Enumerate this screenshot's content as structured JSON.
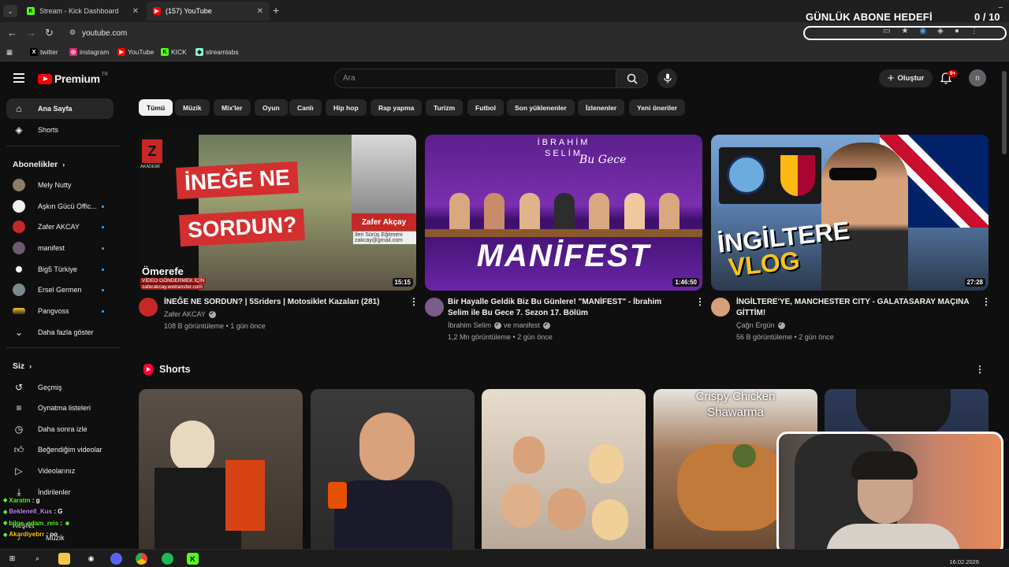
{
  "browser": {
    "tabs": [
      {
        "title": "Stream - Kick Dashboard",
        "active": false
      },
      {
        "title": "(157) YouTube",
        "active": true
      }
    ],
    "url": "youtube.com",
    "bookmarks": [
      "twitter",
      "instagram",
      "YouTube",
      "KICK",
      "streamlabs"
    ]
  },
  "overlay": {
    "goal_title": "GÜNLÜK ABONE HEDEFİ",
    "goal_count": "0 / 10",
    "goal_progress": 0
  },
  "header": {
    "brand": "Premium",
    "region": "TR",
    "search_placeholder": "Ara",
    "create_label": "Oluştur",
    "notification_badge": "9+",
    "avatar_letter": "n"
  },
  "sidebar": {
    "main": [
      {
        "label": "Ana Sayfa",
        "icon": "home-icon",
        "active": true
      },
      {
        "label": "Shorts",
        "icon": "shorts-icon",
        "active": false
      }
    ],
    "subscriptions_title": "Abonelikler",
    "subscriptions": [
      {
        "label": "Mely Nutty",
        "dot": false
      },
      {
        "label": "Aşkın Gücü Offic...",
        "dot": true
      },
      {
        "label": "Zafer AKCAY",
        "dot": true
      },
      {
        "label": "manifest",
        "dot": true
      },
      {
        "label": "Big5 Türkiye",
        "dot": true
      },
      {
        "label": "Ersel Germen",
        "dot": true
      },
      {
        "label": "Pangvoss",
        "dot": true
      }
    ],
    "show_more": "Daha fazla göster",
    "you_title": "Siz",
    "you_items": [
      {
        "label": "Geçmiş",
        "icon": "history-icon"
      },
      {
        "label": "Oynatma listeleri",
        "icon": "playlists-icon"
      },
      {
        "label": "Daha sonra izle",
        "icon": "watch-later-icon"
      },
      {
        "label": "Beğendiğim videolar",
        "icon": "like-icon"
      },
      {
        "label": "Videolarınız",
        "icon": "your-videos-icon"
      },
      {
        "label": "İndirilenler",
        "icon": "download-icon"
      }
    ],
    "explore_title": "Keşfet",
    "explore_items": [
      {
        "label": "Müzik"
      }
    ]
  },
  "chips": [
    "Tümü",
    "Müzik",
    "Mix'ler",
    "Oyun",
    "Canlı",
    "Hip hop",
    "Rap yapma",
    "Turizm",
    "Futbol",
    "Son yüklenenler",
    "İzlenenler",
    "Yeni öneriler"
  ],
  "videos": [
    {
      "title": "İNEĞE NE SORDUN? | 5Sriders | Motosiklet Kazaları (281)",
      "channel": "Zafer AKCAY",
      "verified": true,
      "meta": "108 B görüntüleme • 1 gün önce",
      "duration": "15:15",
      "thumb_text": [
        "İNEĞE NE",
        "SORDUN?"
      ],
      "thumb_small": [
        "AKADEMİ",
        "Ömerefe",
        "VİDEO GÖNDERMEK İÇİN",
        "zaferakcay.wetransfer.com",
        "Zafer Akçay",
        "İleri Sürüş Eğitmeni",
        "zakcay@gmail.com"
      ]
    },
    {
      "title": "Bir Hayalle Geldik Biz Bu Günlere! \"MANİFEST\" - İbrahim Selim ile Bu Gece 7. Sezon 17. Bölüm",
      "channel": "İbrahim Selim",
      "channel_extra": "ve manifest",
      "verified": true,
      "meta": "1,2 Mn görüntüleme • 2 gün önce",
      "duration": "1:46:50",
      "thumb_text": [
        "MANİFEST"
      ],
      "thumb_small": [
        "İBRAHİM",
        "SELİM",
        "Bu Gece"
      ]
    },
    {
      "title": "İNGİLTERE'YE, MANCHESTER CITY - GALATASARAY MAÇINA GİTTİM!",
      "channel": "Çağrı Ergün",
      "verified": true,
      "meta": "56 B görüntüleme • 2 gün önce",
      "duration": "27:28",
      "thumb_text": [
        "İNGİLTERE",
        "VLOG"
      ],
      "thumb_small": []
    }
  ],
  "shorts": {
    "title": "Shorts",
    "items": [
      {
        "overlay_text": ""
      },
      {
        "overlay_text": ""
      },
      {
        "overlay_text": ""
      },
      {
        "overlay_text": "Crispy Chicken Shawarma"
      },
      {
        "overlay_text": ""
      }
    ]
  },
  "chat": [
    {
      "user": "Xaratm",
      "msg": "g",
      "color": "#53fc18"
    },
    {
      "user": "Beklenell_Kus",
      "msg": "G",
      "color": "#c084fc"
    },
    {
      "user": "bilge_adam_reis",
      "msg": "",
      "color": "#53fc18"
    },
    {
      "user": "Akardiyebrr",
      "msg": "oo",
      "color": "#facc15"
    }
  ],
  "taskbar": {
    "date": "16.02.2026"
  },
  "colors": {
    "yt_red": "#ff0000",
    "kick_green": "#53fc18",
    "background": "#0f0f0f",
    "chip_active": "#f1f1f1"
  }
}
